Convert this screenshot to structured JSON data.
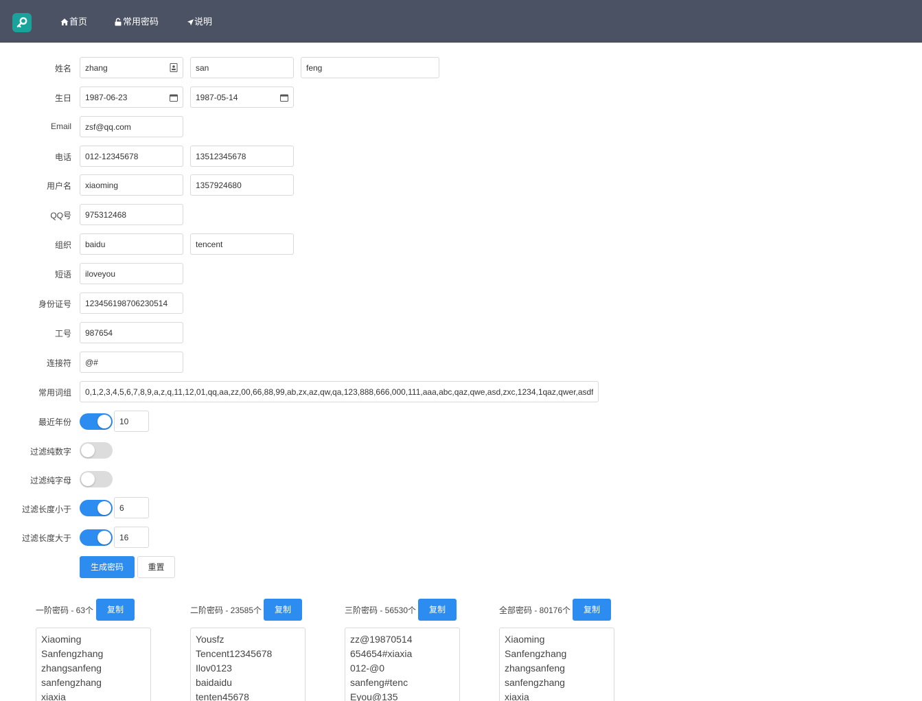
{
  "nav": {
    "home": "首页",
    "common": "常用密码",
    "help": "说明"
  },
  "form": {
    "name": {
      "label": "姓名",
      "values": [
        "zhang",
        "san",
        "feng"
      ]
    },
    "birthday": {
      "label": "生日",
      "values": [
        "1987-06-23",
        "1987-05-14"
      ]
    },
    "email": {
      "label": "Email",
      "value": "zsf@qq.com"
    },
    "phone": {
      "label": "电话",
      "values": [
        "012-12345678",
        "13512345678"
      ]
    },
    "username": {
      "label": "用户名",
      "values": [
        "xiaoming",
        "1357924680"
      ]
    },
    "qq": {
      "label": "QQ号",
      "value": "975312468"
    },
    "org": {
      "label": "组织",
      "values": [
        "baidu",
        "tencent"
      ]
    },
    "phrase": {
      "label": "短语",
      "value": "iloveyou"
    },
    "idcard": {
      "label": "身份证号",
      "value": "123456198706230514"
    },
    "jobno": {
      "label": "工号",
      "value": "987654"
    },
    "connector": {
      "label": "连接符",
      "value": "@#"
    },
    "words": {
      "label": "常用词组",
      "value": "0,1,2,3,4,5,6,7,8,9,a,z,q,11,12,01,qq,aa,zz,00,66,88,99,ab,zx,az,qw,qa,123,888,666,000,111,aaa,abc,qaz,qwe,asd,zxc,1234,1qaz,qwer,asdf"
    },
    "recent_years": {
      "label": "最近年份",
      "enabled": true,
      "value": "10"
    },
    "filter_digits": {
      "label": "过滤纯数字",
      "enabled": false
    },
    "filter_letters": {
      "label": "过滤纯字母",
      "enabled": false
    },
    "filter_min": {
      "label": "过滤长度小于",
      "enabled": true,
      "value": "6"
    },
    "filter_max": {
      "label": "过滤长度大于",
      "enabled": true,
      "value": "16"
    },
    "generate": "生成密码",
    "reset": "重置"
  },
  "results": [
    {
      "label": "一阶密码 - 63个",
      "copy": "复制",
      "lines": [
        "Xiaoming",
        "Sanfengzhang",
        "zhangsanfeng",
        "sanfengzhang",
        "xiaxia"
      ]
    },
    {
      "label": "二阶密码 - 23585个",
      "copy": "复制",
      "lines": [
        "Yousfz",
        "Tencent12345678",
        "Ilov0123",
        "baidaidu",
        "tenten45678"
      ]
    },
    {
      "label": "三阶密码 - 56530个",
      "copy": "复制",
      "lines": [
        "zz@19870514",
        "654654#xiaxia",
        "012-@0",
        "sanfeng#tenc",
        "Eyou@135"
      ]
    },
    {
      "label": "全部密码 - 80176个",
      "copy": "复制",
      "lines": [
        "Xiaoming",
        "Sanfengzhang",
        "zhangsanfeng",
        "sanfengzhang",
        "xiaxia"
      ]
    }
  ],
  "colors": {
    "navbar": "#4b5263",
    "logo": "#1aa39a",
    "primary": "#2d8cf0"
  }
}
